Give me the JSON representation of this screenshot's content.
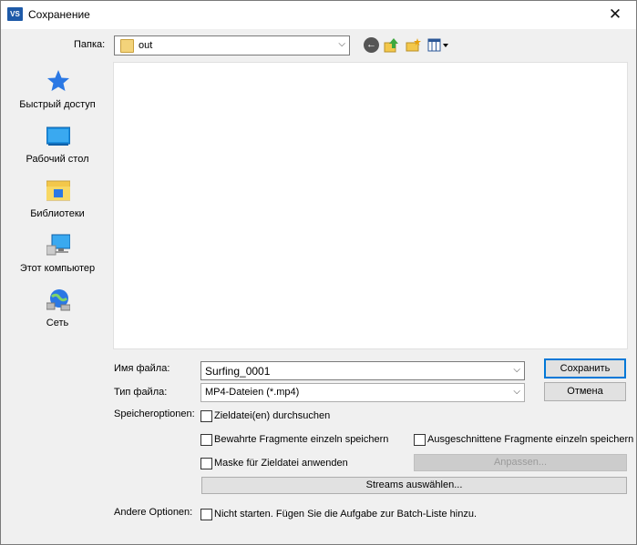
{
  "window": {
    "title": "Сохранение",
    "app_icon_text": "VS",
    "close_glyph": "✕"
  },
  "toolbar": {
    "folder_label": "Папка:",
    "folder_value": "out",
    "icons": [
      "back-icon",
      "up-folder-icon",
      "new-folder-icon",
      "view-menu-icon"
    ]
  },
  "places": [
    {
      "label": "Быстрый доступ",
      "icon": "star-icon"
    },
    {
      "label": "Рабочий стол",
      "icon": "desktop-icon"
    },
    {
      "label": "Библиотеки",
      "icon": "libraries-icon"
    },
    {
      "label": "Этот компьютер",
      "icon": "computer-icon"
    },
    {
      "label": "Сеть",
      "icon": "network-icon"
    }
  ],
  "fields": {
    "filename_label": "Имя файла:",
    "filename_value": "Surfing_0001",
    "filetype_label": "Тип файла:",
    "filetype_value": "MP4-Dateien (*.mp4)"
  },
  "buttons": {
    "save": "Сохранить",
    "cancel": "Отмена",
    "adjust": "Anpassen...",
    "streams": "Streams auswählen..."
  },
  "options": {
    "save_label": "Speicheroptionen:",
    "search_target": "Zieldatei(en) durchsuchen",
    "keep_fragments": "Bewahrte Fragmente einzeln speichern",
    "cut_fragments": "Ausgeschnittene Fragmente einzeln speichern",
    "apply_mask": "Maske für Zieldatei anwenden",
    "other_label": "Andere Optionen:",
    "batch": "Nicht starten. Fügen Sie die Aufgabe zur Batch-Liste hinzu."
  },
  "colors": {
    "accent": "#0078d7",
    "star": "#2b78e4",
    "folder": "#f3d37a"
  }
}
